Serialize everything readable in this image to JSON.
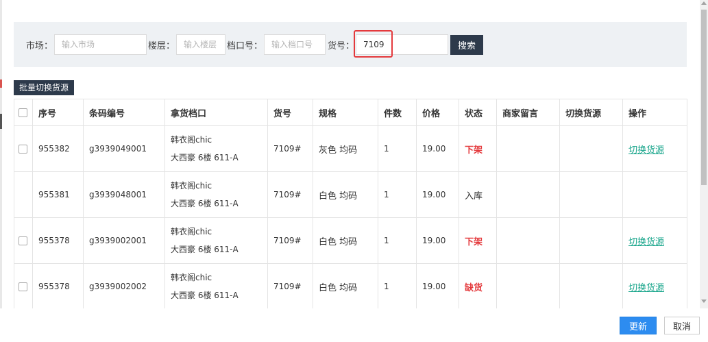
{
  "search": {
    "market_label": "市场：",
    "market_placeholder": "输入市场",
    "floor_label": "楼层：",
    "floor_placeholder": "输入楼层",
    "stall_label": "档口号：",
    "stall_placeholder": "输入档口号",
    "item_label": "货号：",
    "item_value": "7109",
    "search_button": "搜索"
  },
  "batch_button": "批量切换货源",
  "table": {
    "headers": [
      "序号",
      "条码编号",
      "拿货档口",
      "货号",
      "规格",
      "件数",
      "价格",
      "状态",
      "商家留言",
      "切换货源",
      "操作"
    ],
    "rows": [
      {
        "checkbox": true,
        "id": "955382",
        "barcode": "g3939049001",
        "stall_name": "韩衣阁chic",
        "stall_addr": "大西豪 6楼 611-A",
        "item_no": "7109#",
        "spec": "灰色 均码",
        "qty": "1",
        "price": "19.00",
        "status": "下架",
        "status_type": "red",
        "note": "",
        "switch": "",
        "action": "切换货源"
      },
      {
        "checkbox": false,
        "id": "955381",
        "barcode": "g3939048001",
        "stall_name": "韩衣阁chic",
        "stall_addr": "大西豪 6楼 611-A",
        "item_no": "7109#",
        "spec": "白色 均码",
        "qty": "1",
        "price": "19.00",
        "status": "入库",
        "status_type": "normal",
        "note": "",
        "switch": "",
        "action": ""
      },
      {
        "checkbox": true,
        "id": "955378",
        "barcode": "g3939002001",
        "stall_name": "韩衣阁chic",
        "stall_addr": "大西豪 6楼 611-A",
        "item_no": "7109#",
        "spec": "白色 均码",
        "qty": "1",
        "price": "19.00",
        "status": "下架",
        "status_type": "red",
        "note": "",
        "switch": "",
        "action": "切换货源"
      },
      {
        "checkbox": true,
        "id": "955378",
        "barcode": "g3939002002",
        "stall_name": "韩衣阁chic",
        "stall_addr": "大西豪 6楼 611-A",
        "item_no": "7109#",
        "spec": "白色 均码",
        "qty": "1",
        "price": "19.00",
        "status": "缺货",
        "status_type": "red",
        "note": "",
        "switch": "",
        "action": "切换货源"
      }
    ]
  },
  "footer": {
    "update_button": "更新",
    "cancel_button": "取消"
  },
  "colors": {
    "status_red": "#e4393c",
    "link_green": "#1aa68c",
    "primary_blue": "#2d8cf0",
    "dark_button": "#2d3a4b",
    "highlight_red": "#e4393c"
  }
}
